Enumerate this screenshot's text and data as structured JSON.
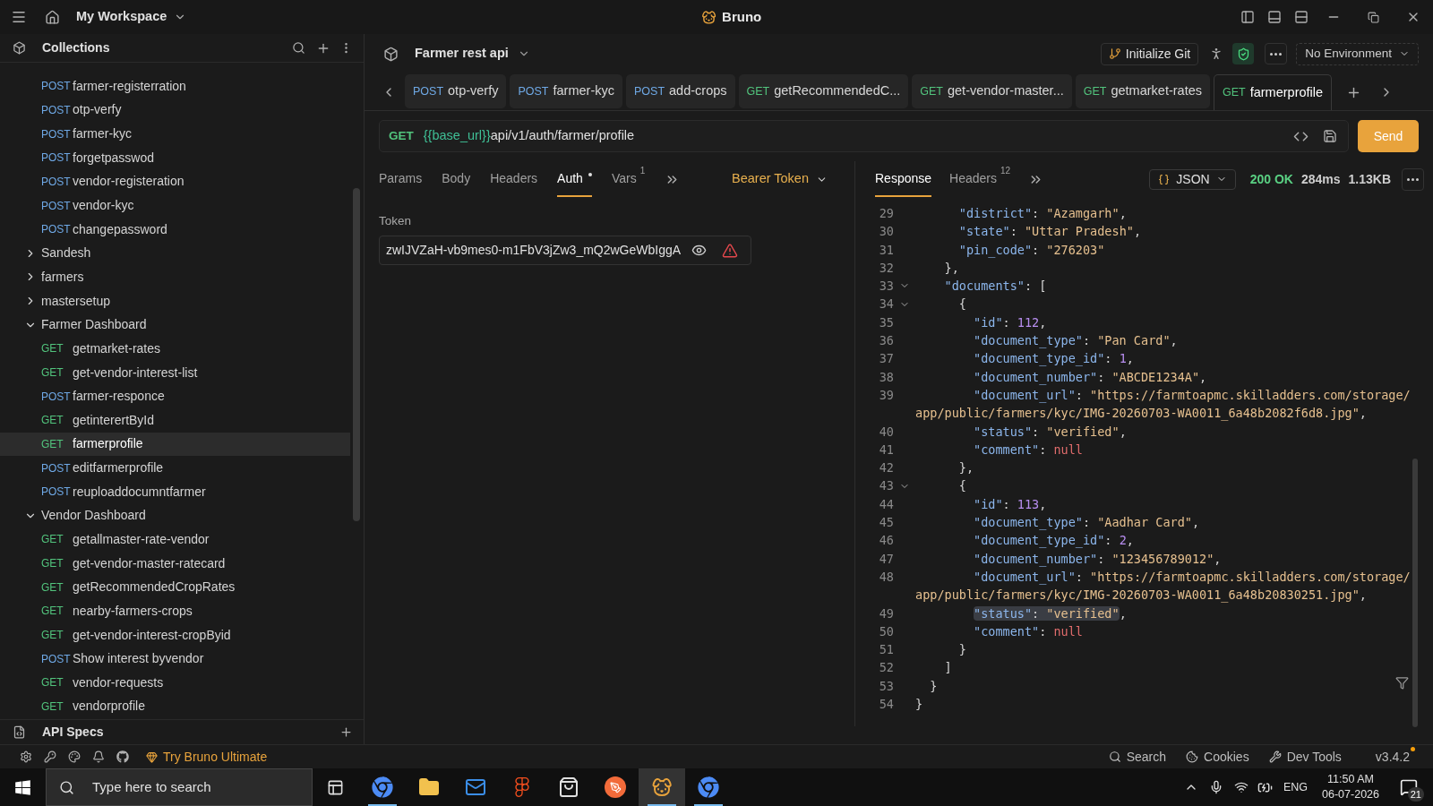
{
  "title_bar": {
    "workspace": "My Workspace",
    "app_title": "Bruno"
  },
  "sidebar": {
    "header": "Collections",
    "items": [
      {
        "kind": "request",
        "method": "POST",
        "name": "farmer-registerration",
        "selected": false
      },
      {
        "kind": "request",
        "method": "POST",
        "name": "otp-verfy",
        "selected": false
      },
      {
        "kind": "request",
        "method": "POST",
        "name": "farmer-kyc",
        "selected": false
      },
      {
        "kind": "request",
        "method": "POST",
        "name": "forgetpasswod",
        "selected": false
      },
      {
        "kind": "request",
        "method": "POST",
        "name": "vendor-registeration",
        "selected": false
      },
      {
        "kind": "request",
        "method": "POST",
        "name": "vendor-kyc",
        "selected": false
      },
      {
        "kind": "request",
        "method": "POST",
        "name": "changepassword",
        "selected": false
      },
      {
        "kind": "folder",
        "name": "Sandesh",
        "expanded": false
      },
      {
        "kind": "folder",
        "name": "farmers",
        "expanded": false
      },
      {
        "kind": "folder",
        "name": "mastersetup",
        "expanded": false
      },
      {
        "kind": "folder",
        "name": "Farmer Dashboard",
        "expanded": true,
        "children": [
          {
            "kind": "request",
            "method": "GET",
            "name": "getmarket-rates",
            "selected": false
          },
          {
            "kind": "request",
            "method": "GET",
            "name": "get-vendor-interest-list",
            "selected": false
          },
          {
            "kind": "request",
            "method": "POST",
            "name": "farmer-responce",
            "selected": false
          },
          {
            "kind": "request",
            "method": "GET",
            "name": "getinterertById",
            "selected": false
          },
          {
            "kind": "request",
            "method": "GET",
            "name": "farmerprofile",
            "selected": true
          },
          {
            "kind": "request",
            "method": "POST",
            "name": "editfarmerprofile",
            "selected": false
          },
          {
            "kind": "request",
            "method": "POST",
            "name": "reuploaddocumntfarmer",
            "selected": false
          }
        ]
      },
      {
        "kind": "folder",
        "name": "Vendor Dashboard",
        "expanded": true,
        "children": [
          {
            "kind": "request",
            "method": "GET",
            "name": "getallmaster-rate-vendor",
            "selected": false
          },
          {
            "kind": "request",
            "method": "GET",
            "name": "get-vendor-master-ratecard",
            "selected": false
          },
          {
            "kind": "request",
            "method": "GET",
            "name": "getRecommendedCropRates",
            "selected": false
          },
          {
            "kind": "request",
            "method": "GET",
            "name": "nearby-farmers-crops",
            "selected": false
          },
          {
            "kind": "request",
            "method": "GET",
            "name": "get-vendor-interest-cropByid",
            "selected": false
          },
          {
            "kind": "request",
            "method": "POST",
            "name": "Show interest byvendor",
            "selected": false
          },
          {
            "kind": "request",
            "method": "GET",
            "name": "vendor-requests",
            "selected": false
          },
          {
            "kind": "request",
            "method": "GET",
            "name": "vendorprofile",
            "selected": false
          }
        ]
      }
    ],
    "api_specs": "API Specs"
  },
  "collection": {
    "name": "Farmer rest api",
    "git_button": "Initialize Git",
    "environment": "No Environment"
  },
  "tabs": [
    {
      "method": "POST",
      "name": "otp-verfy",
      "selected": false
    },
    {
      "method": "POST",
      "name": "farmer-kyc",
      "selected": false
    },
    {
      "method": "POST",
      "name": "add-crops",
      "selected": false
    },
    {
      "method": "GET",
      "name": "getRecommendedC...",
      "selected": false
    },
    {
      "method": "GET",
      "name": "get-vendor-master...",
      "selected": false
    },
    {
      "method": "GET",
      "name": "getmarket-rates",
      "selected": false
    },
    {
      "method": "GET",
      "name": "farmerprofile",
      "selected": true
    }
  ],
  "request": {
    "method": "GET",
    "url_variable": "{{base_url}}",
    "url_path": "api/v1/auth/farmer/profile",
    "send": "Send",
    "tabs": [
      {
        "label": "Params",
        "selected": false,
        "dot": false
      },
      {
        "label": "Body",
        "selected": false,
        "dot": false
      },
      {
        "label": "Headers",
        "selected": false,
        "dot": false
      },
      {
        "label": "Auth",
        "selected": true,
        "dot": true
      },
      {
        "label": "Vars",
        "selected": false,
        "dot": false,
        "count": "1"
      }
    ],
    "auth_mode": "Bearer Token",
    "token_label": "Token",
    "token_value": "zwIJVZaH-vb9mes0-m1FbV3jZw3_mQ2wGeWbIggA"
  },
  "response": {
    "tabs": [
      {
        "label": "Response",
        "selected": true
      },
      {
        "label": "Headers",
        "selected": false,
        "count": "12"
      }
    ],
    "format": "JSON",
    "status": "200 OK",
    "time": "284ms",
    "size": "1.13KB",
    "lines": [
      {
        "num": "29",
        "text": "      \"district\": \"Azamgarh\",",
        "fold": false,
        "selected": false
      },
      {
        "num": "30",
        "text": "      \"state\": \"Uttar Pradesh\",",
        "fold": false,
        "selected": false
      },
      {
        "num": "31",
        "text": "      \"pin_code\": \"276203\"",
        "fold": false,
        "selected": false
      },
      {
        "num": "32",
        "text": "    },",
        "fold": false,
        "selected": false
      },
      {
        "num": "33",
        "text": "    \"documents\": [",
        "fold": true,
        "selected": false
      },
      {
        "num": "34",
        "text": "      {",
        "fold": true,
        "selected": false
      },
      {
        "num": "35",
        "text": "        \"id\": 112,",
        "fold": false,
        "selected": false
      },
      {
        "num": "36",
        "text": "        \"document_type\": \"Pan Card\",",
        "fold": false,
        "selected": false
      },
      {
        "num": "37",
        "text": "        \"document_type_id\": 1,",
        "fold": false,
        "selected": false
      },
      {
        "num": "38",
        "text": "        \"document_number\": \"ABCDE1234A\",",
        "fold": false,
        "selected": false
      },
      {
        "num": "39",
        "text": "        \"document_url\": \"https://farmtoapmc.skilladders.com/storage/app/public/farmers/kyc/IMG-20260703-WA0011_6a48b2082f6d8.jpg\",",
        "fold": false,
        "selected": false
      },
      {
        "num": "40",
        "text": "        \"status\": \"verified\",",
        "fold": false,
        "selected": false
      },
      {
        "num": "41",
        "text": "        \"comment\": null",
        "fold": false,
        "selected": false
      },
      {
        "num": "42",
        "text": "      },",
        "fold": false,
        "selected": false
      },
      {
        "num": "43",
        "text": "      {",
        "fold": true,
        "selected": false
      },
      {
        "num": "44",
        "text": "        \"id\": 113,",
        "fold": false,
        "selected": false
      },
      {
        "num": "45",
        "text": "        \"document_type\": \"Aadhar Card\",",
        "fold": false,
        "selected": false
      },
      {
        "num": "46",
        "text": "        \"document_type_id\": 2,",
        "fold": false,
        "selected": false
      },
      {
        "num": "47",
        "text": "        \"document_number\": \"123456789012\",",
        "fold": false,
        "selected": false
      },
      {
        "num": "48",
        "text": "        \"document_url\": \"https://farmtoapmc.skilladders.com/storage/app/public/farmers/kyc/IMG-20260703-WA0011_6a48b20830251.jpg\",",
        "fold": false,
        "selected": false
      },
      {
        "num": "49",
        "text": "        \"status\": \"verified\",",
        "fold": false,
        "selected": true
      },
      {
        "num": "50",
        "text": "        \"comment\": null",
        "fold": false,
        "selected": false
      },
      {
        "num": "51",
        "text": "      }",
        "fold": false,
        "selected": false
      },
      {
        "num": "52",
        "text": "    ]",
        "fold": false,
        "selected": false
      },
      {
        "num": "53",
        "text": "  }",
        "fold": false,
        "selected": false
      },
      {
        "num": "54",
        "text": "}",
        "fold": false,
        "selected": false
      }
    ]
  },
  "status_bar": {
    "promo": "Try Bruno Ultimate",
    "actions": [
      {
        "kind": "search",
        "label": "Search"
      },
      {
        "kind": "cookies",
        "label": "Cookies"
      },
      {
        "kind": "devtools",
        "label": "Dev Tools"
      }
    ],
    "version": "v3.4.2",
    "update_available": true
  },
  "taskbar": {
    "search_placeholder": "Type here to search",
    "apps": [
      {
        "kind": "chrome",
        "running": true,
        "selected": false
      },
      {
        "kind": "files",
        "running": false,
        "selected": false
      },
      {
        "kind": "mail",
        "running": false,
        "selected": false
      },
      {
        "kind": "figma",
        "running": false,
        "selected": false
      },
      {
        "kind": "store",
        "running": false,
        "selected": false
      },
      {
        "kind": "pen",
        "running": false,
        "selected": false
      },
      {
        "kind": "dog",
        "running": true,
        "selected": true
      },
      {
        "kind": "chrome",
        "running": true,
        "selected": false
      }
    ],
    "language": "ENG",
    "time": "11:50 AM",
    "date": "06-07-2026",
    "notifications": "21"
  }
}
